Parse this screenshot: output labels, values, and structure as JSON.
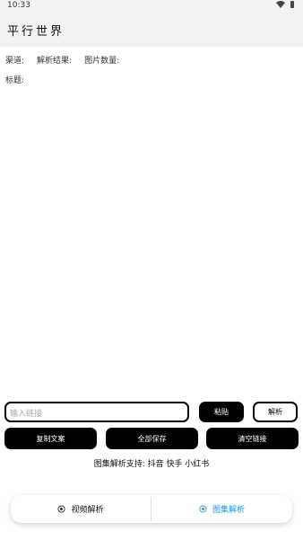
{
  "status_bar": {
    "time": "10:33",
    "icons": [
      "wifi-icon",
      "battery-icon"
    ]
  },
  "app_bar": {
    "title": "平行世界"
  },
  "info": {
    "channel_label": "渠道:",
    "result_label": "解析结果:",
    "image_count_label": "图片数量:",
    "title_label": "标题:"
  },
  "controls": {
    "link_input_placeholder": "输入链接",
    "paste_label": "粘贴",
    "parse_label": "解析",
    "copy_text_label": "复制文案",
    "save_all_label": "全部保存",
    "clear_link_label": "清空链接"
  },
  "support_text": "图集解析支持: 抖音 快手 小红书",
  "bottom_nav": {
    "items": [
      {
        "label": "视频解析",
        "icon": "video-parse-icon",
        "active": false
      },
      {
        "label": "图集解析",
        "icon": "gallery-parse-icon",
        "active": true
      }
    ],
    "active_color": "#2196f3"
  }
}
